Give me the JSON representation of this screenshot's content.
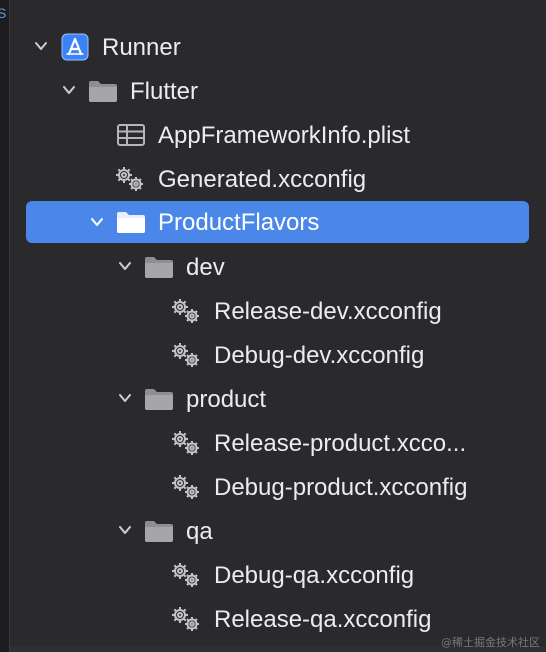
{
  "tree": {
    "edge_glyph": "S",
    "items": [
      {
        "label": "Runner",
        "kind": "project",
        "expanded": true,
        "depth": 0
      },
      {
        "label": "Flutter",
        "kind": "folder",
        "expanded": true,
        "depth": 1
      },
      {
        "label": "AppFrameworkInfo.plist",
        "kind": "plist",
        "depth": 2
      },
      {
        "label": "Generated.xcconfig",
        "kind": "config",
        "depth": 2
      },
      {
        "label": "ProductFlavors",
        "kind": "folder",
        "expanded": true,
        "depth": 1,
        "selected": true
      },
      {
        "label": "dev",
        "kind": "folder",
        "expanded": true,
        "depth": 2
      },
      {
        "label": "Release-dev.xcconfig",
        "kind": "config",
        "depth": 3
      },
      {
        "label": "Debug-dev.xcconfig",
        "kind": "config",
        "depth": 3
      },
      {
        "label": "product",
        "kind": "folder",
        "expanded": true,
        "depth": 2
      },
      {
        "label": "Release-product.xcco...",
        "kind": "config",
        "depth": 3
      },
      {
        "label": "Debug-product.xcconfig",
        "kind": "config",
        "depth": 3
      },
      {
        "label": "qa",
        "kind": "folder",
        "expanded": true,
        "depth": 2
      },
      {
        "label": "Debug-qa.xcconfig",
        "kind": "config",
        "depth": 3
      },
      {
        "label": "Release-qa.xcconfig",
        "kind": "config",
        "depth": 3
      }
    ]
  },
  "watermark": "@稀土掘金技术社区",
  "colors": {
    "background": "#2a2a2d",
    "selection": "#4a87e8",
    "folder": "#9a9a9e",
    "project_icon": "#3b82f6",
    "text": "#ececee"
  }
}
